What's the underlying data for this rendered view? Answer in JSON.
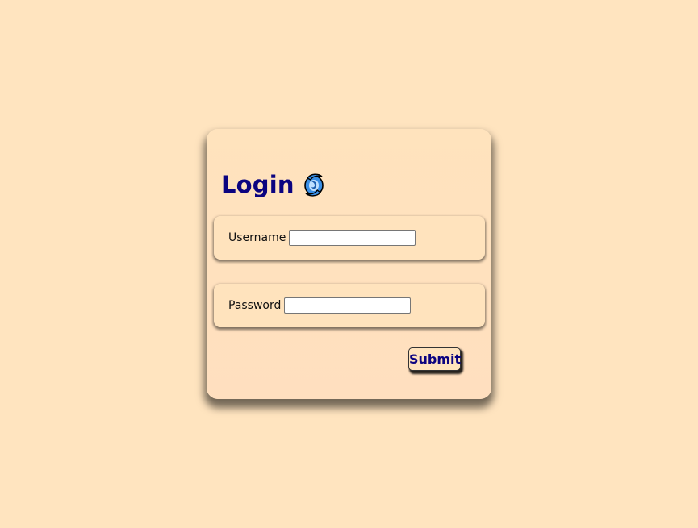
{
  "login": {
    "title": "Login",
    "logo_icon": "swirl-logo-icon",
    "username": {
      "label": "Username",
      "value": ""
    },
    "password": {
      "label": "Password",
      "value": ""
    },
    "submit_label": "Submit"
  },
  "colors": {
    "background": "#ffe4bf",
    "title": "#0b0380",
    "logo_blue": "#3a8fe6"
  }
}
